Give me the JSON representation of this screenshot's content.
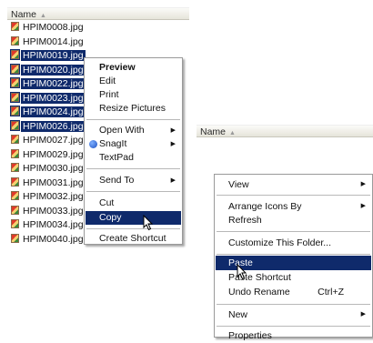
{
  "left_pane": {
    "header": "Name",
    "files": [
      {
        "name": "HPIM0008.jpg",
        "selected": false
      },
      {
        "name": "HPIM0014.jpg",
        "selected": false
      },
      {
        "name": "HPIM0019.jpg",
        "selected": true
      },
      {
        "name": "HPIM0020.jpg",
        "selected": true
      },
      {
        "name": "HPIM0022.jpg",
        "selected": true
      },
      {
        "name": "HPIM0023.jpg",
        "selected": true
      },
      {
        "name": "HPIM0024.jpg",
        "selected": true
      },
      {
        "name": "HPIM0026.jpg",
        "selected": true
      },
      {
        "name": "HPIM0027.jpg",
        "selected": false
      },
      {
        "name": "HPIM0029.jpg",
        "selected": false
      },
      {
        "name": "HPIM0030.jpg",
        "selected": false
      },
      {
        "name": "HPIM0031.jpg",
        "selected": false
      },
      {
        "name": "HPIM0032.jpg",
        "selected": false
      },
      {
        "name": "HPIM0033.jpg",
        "selected": false
      },
      {
        "name": "HPIM0034.jpg",
        "selected": false
      },
      {
        "name": "HPIM0040.jpg",
        "selected": false
      }
    ]
  },
  "context_menu_1": {
    "items": {
      "preview": "Preview",
      "edit": "Edit",
      "print": "Print",
      "resize": "Resize Pictures",
      "open_with": "Open With",
      "snagit": "SnagIt",
      "textpad": "TextPad",
      "send_to": "Send To",
      "cut": "Cut",
      "copy": "Copy",
      "create_shortcut": "Create Shortcut"
    }
  },
  "right_pane": {
    "header": "Name"
  },
  "context_menu_2": {
    "items": {
      "view": "View",
      "arrange": "Arrange Icons By",
      "refresh": "Refresh",
      "customize": "Customize This Folder...",
      "paste": "Paste",
      "paste_shortcut": "Paste Shortcut",
      "undo_rename": "Undo Rename",
      "undo_shortcut": "Ctrl+Z",
      "new": "New",
      "properties": "Properties"
    }
  },
  "colors": {
    "selection": "#0f2a6b",
    "selection_text": "#ffffff"
  }
}
